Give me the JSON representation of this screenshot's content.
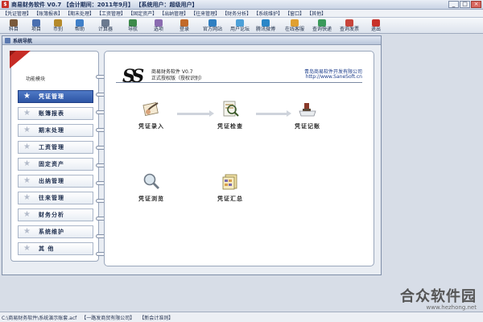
{
  "titlebar": {
    "app_icon_text": "$",
    "title": "商易财务软件 V0.7  【会计期间：2011年9月】 【系统用户：超级用户】",
    "buttons": [
      "_",
      "□",
      "×"
    ]
  },
  "menubar": {
    "items": [
      "【凭证管理】",
      "【账簿报表】",
      "【期末处理】",
      "【工资管理】",
      "【固定资产】",
      "【出纳管理】",
      "【往来管理】",
      "【财务分析】",
      "【系统维护】",
      "【窗口】",
      "【其他】"
    ]
  },
  "toolbar": {
    "items": [
      {
        "label": "科目",
        "icon": "subject-icon",
        "color": "#7a5a3a"
      },
      {
        "label": "项目",
        "icon": "project-icon",
        "color": "#4a6fb0"
      },
      {
        "label": "币别",
        "icon": "currency-icon",
        "color": "#b58a2a"
      },
      {
        "label": "帮助",
        "icon": "help-icon",
        "color": "#3f7fc8"
      },
      {
        "label": "计算器",
        "icon": "calculator-icon",
        "color": "#6b7a8f"
      },
      {
        "label": "导航",
        "icon": "navigation-icon",
        "color": "#3d8a4a"
      },
      {
        "label": "选项",
        "icon": "options-icon",
        "color": "#8a6bb0"
      },
      {
        "label": "登录",
        "icon": "login-icon",
        "color": "#c26a2a"
      },
      {
        "label": "官方网站",
        "icon": "website-icon",
        "color": "#2f7fc1"
      },
      {
        "label": "用户论坛",
        "icon": "forum-icon",
        "color": "#4ca0d8"
      },
      {
        "label": "腾讯微博",
        "icon": "weibo-icon",
        "color": "#2a86c7"
      },
      {
        "label": "在线客服",
        "icon": "service-icon",
        "color": "#e0a030"
      },
      {
        "label": "查询快递",
        "icon": "express-icon",
        "color": "#3a9a5a"
      },
      {
        "label": "查询发票",
        "icon": "invoice-icon",
        "color": "#c8443a"
      },
      {
        "label": "退出",
        "icon": "exit-icon",
        "color": "#c8322a"
      }
    ]
  },
  "navwin": {
    "title": "系统导航"
  },
  "leftpanel": {
    "caption": "功能模块",
    "buttons": [
      "凭证管理",
      "账簿报表",
      "期末处理",
      "工资管理",
      "固定资产",
      "出纳管理",
      "往来管理",
      "财务分析",
      "系统维护",
      "其 他"
    ],
    "active_index": 0
  },
  "rightpanel": {
    "logo_text": "SS",
    "software_name": "商易财务软件 V0.7",
    "license_text": "正式授权版（授权识别）",
    "company": "青岛商易软件开发有限公司",
    "url": "http://www.SaneSoft.cn",
    "features": {
      "entry": "凭证录入",
      "check": "凭证检查",
      "post": "凭证记账",
      "browse": "凭证浏览",
      "summary": "凭证汇总"
    }
  },
  "statusbar": {
    "segments": [
      "C:\\商易财务软件\\系统演示账套.acf",
      "【一路发商贸有限公司】",
      "【新会计准则】"
    ]
  },
  "watermark": {
    "title": "合众软件园",
    "url": "www.hezhong.net"
  }
}
